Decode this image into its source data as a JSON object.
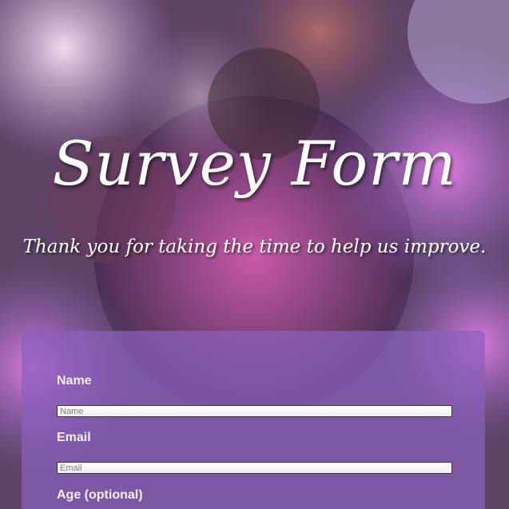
{
  "header": {
    "title": "Survey Form",
    "subtitle": "Thank you for taking the time to help us improve."
  },
  "form": {
    "name": {
      "label": "Name",
      "placeholder": "Name",
      "value": ""
    },
    "email": {
      "label": "Email",
      "placeholder": "Email",
      "value": ""
    },
    "age": {
      "label": "Age (optional)"
    }
  },
  "colors": {
    "form_background": "#8a60be",
    "title_text": "#ffffff",
    "label_text": "#f3eef7"
  }
}
